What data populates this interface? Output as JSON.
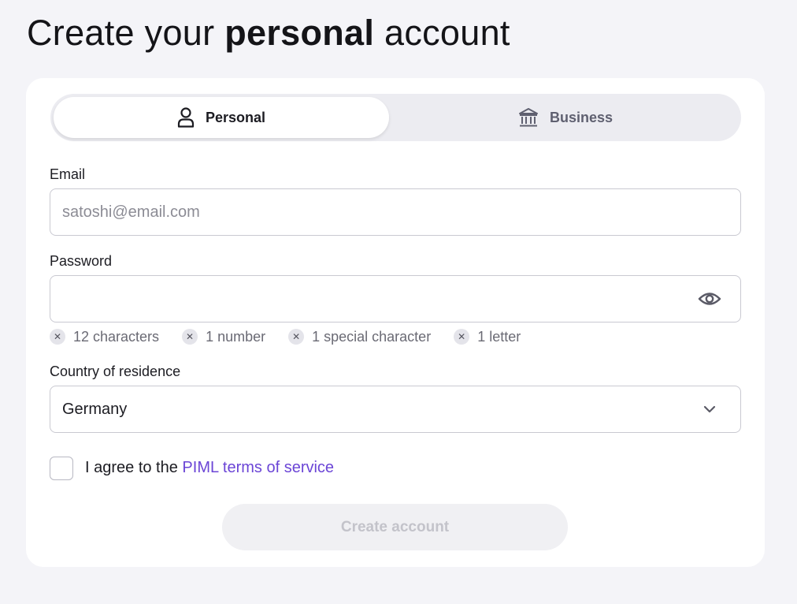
{
  "title": {
    "prefix": "Create your ",
    "bold": "personal",
    "suffix": " account"
  },
  "account_type": {
    "tabs": [
      {
        "label": "Personal",
        "icon": "user-icon",
        "selected": true
      },
      {
        "label": "Business",
        "icon": "bank-icon",
        "selected": false
      }
    ]
  },
  "email": {
    "label": "Email",
    "placeholder": "satoshi@email.com",
    "value": ""
  },
  "password": {
    "label": "Password",
    "value": "",
    "toggle_icon": "eye-icon",
    "requirements": [
      {
        "text": "12 characters",
        "met": false
      },
      {
        "text": "1 number",
        "met": false
      },
      {
        "text": "1 special character",
        "met": false
      },
      {
        "text": "1 letter",
        "met": false
      }
    ]
  },
  "country": {
    "label": "Country of residence",
    "value": "Germany"
  },
  "terms": {
    "checked": false,
    "text": "I agree to the ",
    "link_text": "PIML terms of service"
  },
  "submit": {
    "label": "Create account",
    "enabled": false
  },
  "colors": {
    "accent_link": "#6b45d6",
    "background": "#f4f4f8",
    "card": "#ffffff"
  }
}
